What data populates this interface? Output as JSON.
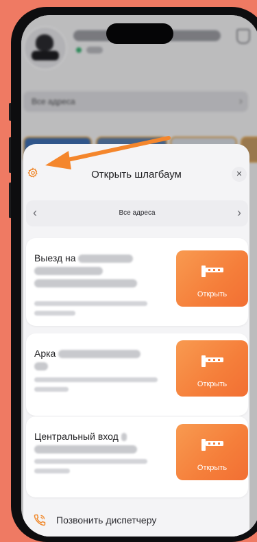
{
  "background_app": {
    "address_selector": "Все адреса"
  },
  "sheet": {
    "title": "Открыть шлагбаум",
    "address_selector": {
      "label": "Все адреса"
    },
    "barriers": [
      {
        "title": "Выезд на",
        "button_label": "Открыть"
      },
      {
        "title": "Арка",
        "button_label": "Открыть"
      },
      {
        "title": "Центральный вход",
        "button_label": "Открыть"
      }
    ],
    "call_dispatcher": "Позвонить диспетчеру"
  },
  "colors": {
    "backdrop": "#ef7a63",
    "accent": "#f57e3a",
    "arrow": "#f4862c",
    "online": "#3bb273"
  }
}
